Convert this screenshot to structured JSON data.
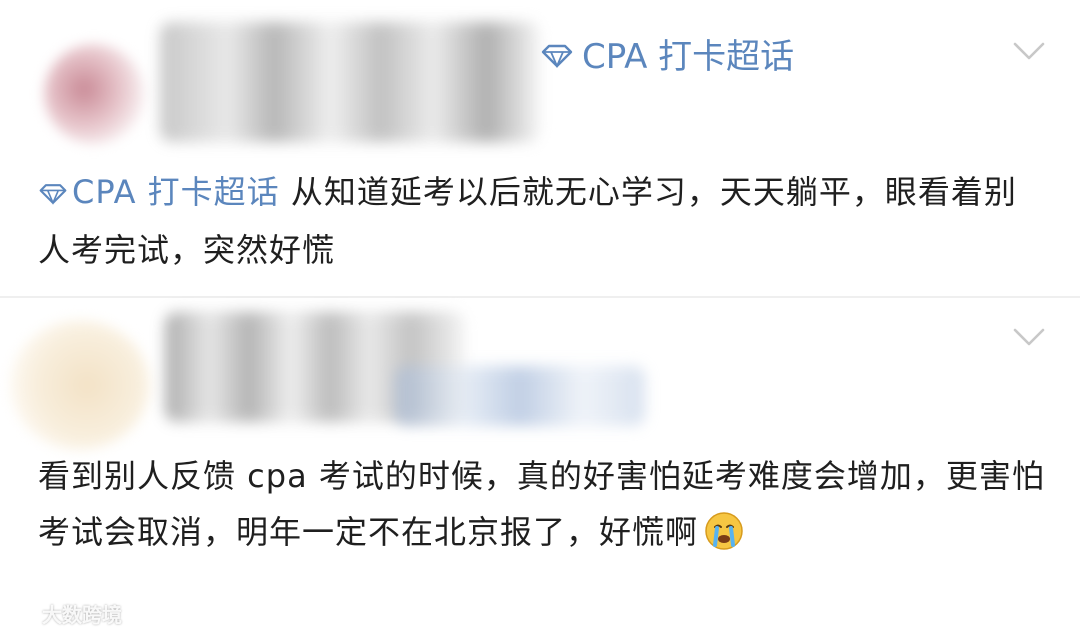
{
  "posts": [
    {
      "topic_tag": "CPA 打卡超话",
      "content_topic": "CPA 打卡超话",
      "content_text": "从知道延考以后就无心学习，天天躺平，眼看着别人考完试，突然好慌"
    },
    {
      "content_text": "看到别人反馈 cpa 考试的时候，真的好害怕延考难度会增加，更害怕考试会取消，明年一定不在北京报了，好慌啊"
    }
  ],
  "watermark": {
    "text": "大数跨境"
  },
  "colors": {
    "topic_blue": "#5b86bd",
    "text": "#1f1f1f",
    "chevron": "#c8c8c8"
  },
  "icons": {
    "topic": "diamond-gem-icon",
    "expand": "chevron-down-icon",
    "emoji": "crying-face-emoji"
  }
}
